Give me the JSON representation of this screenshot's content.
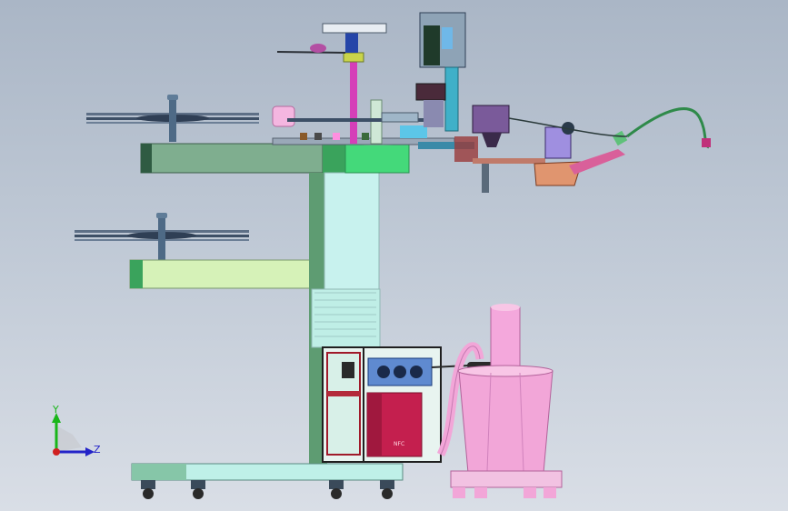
{
  "viewport": {
    "background_top": "#aab6c6",
    "background_bottom": "#d9dee6"
  },
  "triad": {
    "y_label": "Y",
    "z_label": "Z",
    "y_color": "#19b619",
    "z_color": "#2323c8",
    "origin_color": "#d02020"
  },
  "machine": {
    "controller_label": "NFC",
    "colors": {
      "frame_green": "#8fb89c",
      "arm_light_green": "#d6f2b8",
      "column_cyan": "#c8f2ee",
      "base_cyan": "#bff0e8",
      "cabinet_red": "#c41f4e",
      "bucket_pink": "#f2a6d8",
      "pink_rod": "#d53fb8"
    }
  }
}
